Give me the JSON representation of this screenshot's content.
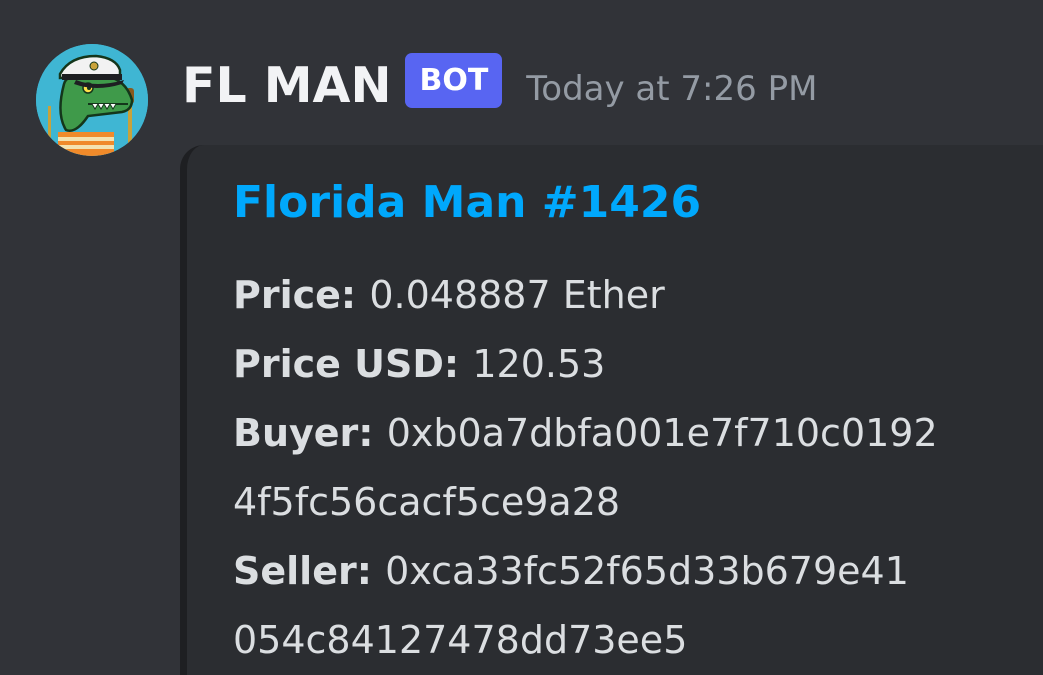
{
  "message": {
    "author": "FL MAN",
    "bot_tag": "BOT",
    "timestamp": "Today at 7:26 PM",
    "avatar_icon": "crocodile-captain-avatar"
  },
  "embed": {
    "title": "Florida Man #1426",
    "title_color": "#00a8fc",
    "fields": {
      "price_label": "Price:",
      "price_value": "0.048887 Ether",
      "price_usd_label": "Price USD:",
      "price_usd_value": "120.53",
      "buyer_label": "Buyer:",
      "buyer_value_line1": "0xb0a7dbfa001e7f710c0192",
      "buyer_value_line2": "4f5fc56cacf5ce9a28",
      "seller_label": "Seller:",
      "seller_value_line1": "0xca33fc52f65d33b679e41",
      "seller_value_line2": "054c84127478dd73ee5"
    }
  },
  "colors": {
    "background": "#313338",
    "embed_background": "#2b2d31",
    "bot_tag": "#5865f2"
  }
}
